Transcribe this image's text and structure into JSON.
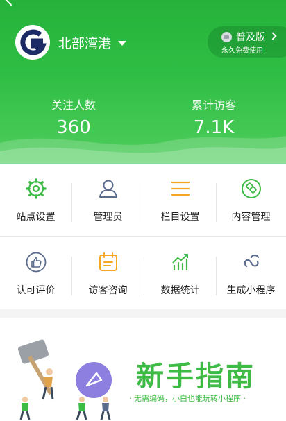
{
  "header": {
    "site_name": "北部湾港",
    "version": {
      "name": "普及版",
      "subtitle": "永久免费使用"
    },
    "stats": [
      {
        "label": "关注人数",
        "value": "360"
      },
      {
        "label": "累计访客",
        "value": "7.1K"
      }
    ]
  },
  "menu": [
    {
      "label": "站点设置",
      "icon": "gear-icon",
      "color": "#3dbb45"
    },
    {
      "label": "管理员",
      "icon": "user-icon",
      "color": "#5a6b8c"
    },
    {
      "label": "栏目设置",
      "icon": "list-icon",
      "color": "#f5a623"
    },
    {
      "label": "内容管理",
      "icon": "content-icon",
      "color": "#3dbb45"
    },
    {
      "label": "认可评价",
      "icon": "thumbs-up-icon",
      "color": "#5a6b8c"
    },
    {
      "label": "访客咨询",
      "icon": "calendar-icon",
      "color": "#f5a623"
    },
    {
      "label": "数据统计",
      "icon": "chart-icon",
      "color": "#3dbb45"
    },
    {
      "label": "生成小程序",
      "icon": "link-icon",
      "color": "#5a6b8c"
    }
  ],
  "banner": {
    "title": "新手指南",
    "subtitle": "· 无需编码，小白也能玩转小程序 ·"
  }
}
